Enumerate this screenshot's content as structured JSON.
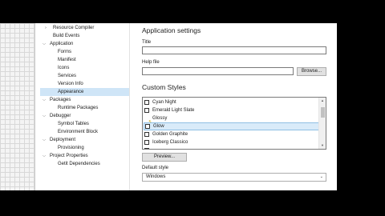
{
  "tree": {
    "items": [
      {
        "label": "Resource Compiler",
        "level": 2
      },
      {
        "label": "Build Events",
        "level": 2
      },
      {
        "label": "Application",
        "level": 1
      },
      {
        "label": "Forms",
        "level": 2
      },
      {
        "label": "Manifest",
        "level": 2
      },
      {
        "label": "Icons",
        "level": 2
      },
      {
        "label": "Services",
        "level": 2
      },
      {
        "label": "Version Info",
        "level": 2
      },
      {
        "label": "Appearance",
        "level": 2,
        "selected": true
      },
      {
        "label": "Packages",
        "level": 1
      },
      {
        "label": "Runtime Packages",
        "level": 2
      },
      {
        "label": "Debugger",
        "level": 1
      },
      {
        "label": "Symbol Tables",
        "level": 2
      },
      {
        "label": "Environment Block",
        "level": 2
      },
      {
        "label": "Deployment",
        "level": 1
      },
      {
        "label": "Provisioning",
        "level": 2
      },
      {
        "label": "Project Properties",
        "level": 1
      },
      {
        "label": "Getit Dependencies",
        "level": 2
      }
    ]
  },
  "settings": {
    "app_settings_title": "Application settings",
    "title_label": "Title",
    "title_value": "",
    "helpfile_label": "Help file",
    "helpfile_value": "",
    "browse_label": "Browse...",
    "custom_styles_title": "Custom Styles",
    "styles": [
      {
        "label": "Cyan Night",
        "checked": false,
        "selected": false
      },
      {
        "label": "Emerald Light Slate",
        "checked": false,
        "selected": false
      },
      {
        "label": "Glossy",
        "checked": false,
        "selected": false
      },
      {
        "label": "Glow",
        "checked": false,
        "selected": true
      },
      {
        "label": "Golden Graphite",
        "checked": false,
        "selected": false
      },
      {
        "label": "Iceberg Classico",
        "checked": false,
        "selected": false
      }
    ],
    "preview_label": "Preview...",
    "default_style_label": "Default style",
    "default_style_value": "Windows"
  },
  "colors": {
    "selection": "#cfe5f7",
    "list_selection": "#d9ebf9",
    "background": "#ffffff",
    "letterbox": "#000000"
  }
}
